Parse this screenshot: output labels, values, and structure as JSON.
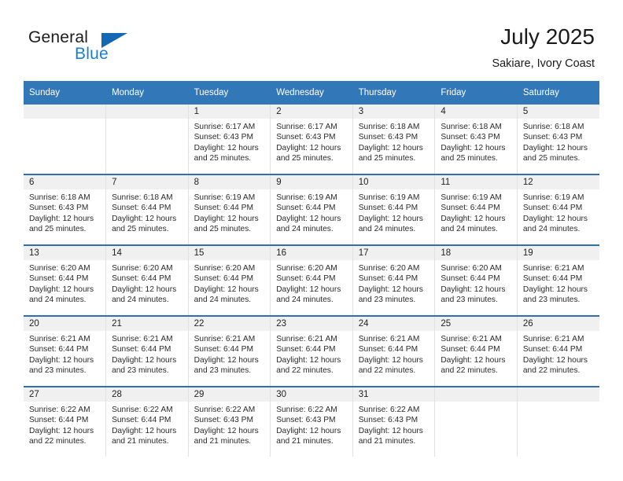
{
  "brand": {
    "name_part1": "General",
    "name_part2": "Blue",
    "triangle_color": "#1268b3",
    "blue_text_color": "#1a7fd4"
  },
  "header": {
    "month_title": "July 2025",
    "location": "Sakiare, Ivory Coast"
  },
  "theme": {
    "header_blue": "#3277b8",
    "row_separator_blue": "#2f6fb0",
    "daynum_band_gray": "#f0f0f0",
    "column_divider": "#e2e2e2"
  },
  "weekday_headers": [
    "Sunday",
    "Monday",
    "Tuesday",
    "Wednesday",
    "Thursday",
    "Friday",
    "Saturday"
  ],
  "weeks": [
    [
      {
        "day": "",
        "empty": true,
        "sunrise": "",
        "sunset": "",
        "daylight_line1": "",
        "daylight_line2": ""
      },
      {
        "day": "",
        "empty": true,
        "sunrise": "",
        "sunset": "",
        "daylight_line1": "",
        "daylight_line2": ""
      },
      {
        "day": "1",
        "empty": false,
        "sunrise": "Sunrise: 6:17 AM",
        "sunset": "Sunset: 6:43 PM",
        "daylight_line1": "Daylight: 12 hours",
        "daylight_line2": "and 25 minutes."
      },
      {
        "day": "2",
        "empty": false,
        "sunrise": "Sunrise: 6:17 AM",
        "sunset": "Sunset: 6:43 PM",
        "daylight_line1": "Daylight: 12 hours",
        "daylight_line2": "and 25 minutes."
      },
      {
        "day": "3",
        "empty": false,
        "sunrise": "Sunrise: 6:18 AM",
        "sunset": "Sunset: 6:43 PM",
        "daylight_line1": "Daylight: 12 hours",
        "daylight_line2": "and 25 minutes."
      },
      {
        "day": "4",
        "empty": false,
        "sunrise": "Sunrise: 6:18 AM",
        "sunset": "Sunset: 6:43 PM",
        "daylight_line1": "Daylight: 12 hours",
        "daylight_line2": "and 25 minutes."
      },
      {
        "day": "5",
        "empty": false,
        "sunrise": "Sunrise: 6:18 AM",
        "sunset": "Sunset: 6:43 PM",
        "daylight_line1": "Daylight: 12 hours",
        "daylight_line2": "and 25 minutes."
      }
    ],
    [
      {
        "day": "6",
        "empty": false,
        "sunrise": "Sunrise: 6:18 AM",
        "sunset": "Sunset: 6:43 PM",
        "daylight_line1": "Daylight: 12 hours",
        "daylight_line2": "and 25 minutes."
      },
      {
        "day": "7",
        "empty": false,
        "sunrise": "Sunrise: 6:18 AM",
        "sunset": "Sunset: 6:44 PM",
        "daylight_line1": "Daylight: 12 hours",
        "daylight_line2": "and 25 minutes."
      },
      {
        "day": "8",
        "empty": false,
        "sunrise": "Sunrise: 6:19 AM",
        "sunset": "Sunset: 6:44 PM",
        "daylight_line1": "Daylight: 12 hours",
        "daylight_line2": "and 25 minutes."
      },
      {
        "day": "9",
        "empty": false,
        "sunrise": "Sunrise: 6:19 AM",
        "sunset": "Sunset: 6:44 PM",
        "daylight_line1": "Daylight: 12 hours",
        "daylight_line2": "and 24 minutes."
      },
      {
        "day": "10",
        "empty": false,
        "sunrise": "Sunrise: 6:19 AM",
        "sunset": "Sunset: 6:44 PM",
        "daylight_line1": "Daylight: 12 hours",
        "daylight_line2": "and 24 minutes."
      },
      {
        "day": "11",
        "empty": false,
        "sunrise": "Sunrise: 6:19 AM",
        "sunset": "Sunset: 6:44 PM",
        "daylight_line1": "Daylight: 12 hours",
        "daylight_line2": "and 24 minutes."
      },
      {
        "day": "12",
        "empty": false,
        "sunrise": "Sunrise: 6:19 AM",
        "sunset": "Sunset: 6:44 PM",
        "daylight_line1": "Daylight: 12 hours",
        "daylight_line2": "and 24 minutes."
      }
    ],
    [
      {
        "day": "13",
        "empty": false,
        "sunrise": "Sunrise: 6:20 AM",
        "sunset": "Sunset: 6:44 PM",
        "daylight_line1": "Daylight: 12 hours",
        "daylight_line2": "and 24 minutes."
      },
      {
        "day": "14",
        "empty": false,
        "sunrise": "Sunrise: 6:20 AM",
        "sunset": "Sunset: 6:44 PM",
        "daylight_line1": "Daylight: 12 hours",
        "daylight_line2": "and 24 minutes."
      },
      {
        "day": "15",
        "empty": false,
        "sunrise": "Sunrise: 6:20 AM",
        "sunset": "Sunset: 6:44 PM",
        "daylight_line1": "Daylight: 12 hours",
        "daylight_line2": "and 24 minutes."
      },
      {
        "day": "16",
        "empty": false,
        "sunrise": "Sunrise: 6:20 AM",
        "sunset": "Sunset: 6:44 PM",
        "daylight_line1": "Daylight: 12 hours",
        "daylight_line2": "and 24 minutes."
      },
      {
        "day": "17",
        "empty": false,
        "sunrise": "Sunrise: 6:20 AM",
        "sunset": "Sunset: 6:44 PM",
        "daylight_line1": "Daylight: 12 hours",
        "daylight_line2": "and 23 minutes."
      },
      {
        "day": "18",
        "empty": false,
        "sunrise": "Sunrise: 6:20 AM",
        "sunset": "Sunset: 6:44 PM",
        "daylight_line1": "Daylight: 12 hours",
        "daylight_line2": "and 23 minutes."
      },
      {
        "day": "19",
        "empty": false,
        "sunrise": "Sunrise: 6:21 AM",
        "sunset": "Sunset: 6:44 PM",
        "daylight_line1": "Daylight: 12 hours",
        "daylight_line2": "and 23 minutes."
      }
    ],
    [
      {
        "day": "20",
        "empty": false,
        "sunrise": "Sunrise: 6:21 AM",
        "sunset": "Sunset: 6:44 PM",
        "daylight_line1": "Daylight: 12 hours",
        "daylight_line2": "and 23 minutes."
      },
      {
        "day": "21",
        "empty": false,
        "sunrise": "Sunrise: 6:21 AM",
        "sunset": "Sunset: 6:44 PM",
        "daylight_line1": "Daylight: 12 hours",
        "daylight_line2": "and 23 minutes."
      },
      {
        "day": "22",
        "empty": false,
        "sunrise": "Sunrise: 6:21 AM",
        "sunset": "Sunset: 6:44 PM",
        "daylight_line1": "Daylight: 12 hours",
        "daylight_line2": "and 23 minutes."
      },
      {
        "day": "23",
        "empty": false,
        "sunrise": "Sunrise: 6:21 AM",
        "sunset": "Sunset: 6:44 PM",
        "daylight_line1": "Daylight: 12 hours",
        "daylight_line2": "and 22 minutes."
      },
      {
        "day": "24",
        "empty": false,
        "sunrise": "Sunrise: 6:21 AM",
        "sunset": "Sunset: 6:44 PM",
        "daylight_line1": "Daylight: 12 hours",
        "daylight_line2": "and 22 minutes."
      },
      {
        "day": "25",
        "empty": false,
        "sunrise": "Sunrise: 6:21 AM",
        "sunset": "Sunset: 6:44 PM",
        "daylight_line1": "Daylight: 12 hours",
        "daylight_line2": "and 22 minutes."
      },
      {
        "day": "26",
        "empty": false,
        "sunrise": "Sunrise: 6:21 AM",
        "sunset": "Sunset: 6:44 PM",
        "daylight_line1": "Daylight: 12 hours",
        "daylight_line2": "and 22 minutes."
      }
    ],
    [
      {
        "day": "27",
        "empty": false,
        "sunrise": "Sunrise: 6:22 AM",
        "sunset": "Sunset: 6:44 PM",
        "daylight_line1": "Daylight: 12 hours",
        "daylight_line2": "and 22 minutes."
      },
      {
        "day": "28",
        "empty": false,
        "sunrise": "Sunrise: 6:22 AM",
        "sunset": "Sunset: 6:44 PM",
        "daylight_line1": "Daylight: 12 hours",
        "daylight_line2": "and 21 minutes."
      },
      {
        "day": "29",
        "empty": false,
        "sunrise": "Sunrise: 6:22 AM",
        "sunset": "Sunset: 6:43 PM",
        "daylight_line1": "Daylight: 12 hours",
        "daylight_line2": "and 21 minutes."
      },
      {
        "day": "30",
        "empty": false,
        "sunrise": "Sunrise: 6:22 AM",
        "sunset": "Sunset: 6:43 PM",
        "daylight_line1": "Daylight: 12 hours",
        "daylight_line2": "and 21 minutes."
      },
      {
        "day": "31",
        "empty": false,
        "sunrise": "Sunrise: 6:22 AM",
        "sunset": "Sunset: 6:43 PM",
        "daylight_line1": "Daylight: 12 hours",
        "daylight_line2": "and 21 minutes."
      },
      {
        "day": "",
        "empty": true,
        "sunrise": "",
        "sunset": "",
        "daylight_line1": "",
        "daylight_line2": ""
      },
      {
        "day": "",
        "empty": true,
        "sunrise": "",
        "sunset": "",
        "daylight_line1": "",
        "daylight_line2": ""
      }
    ]
  ]
}
